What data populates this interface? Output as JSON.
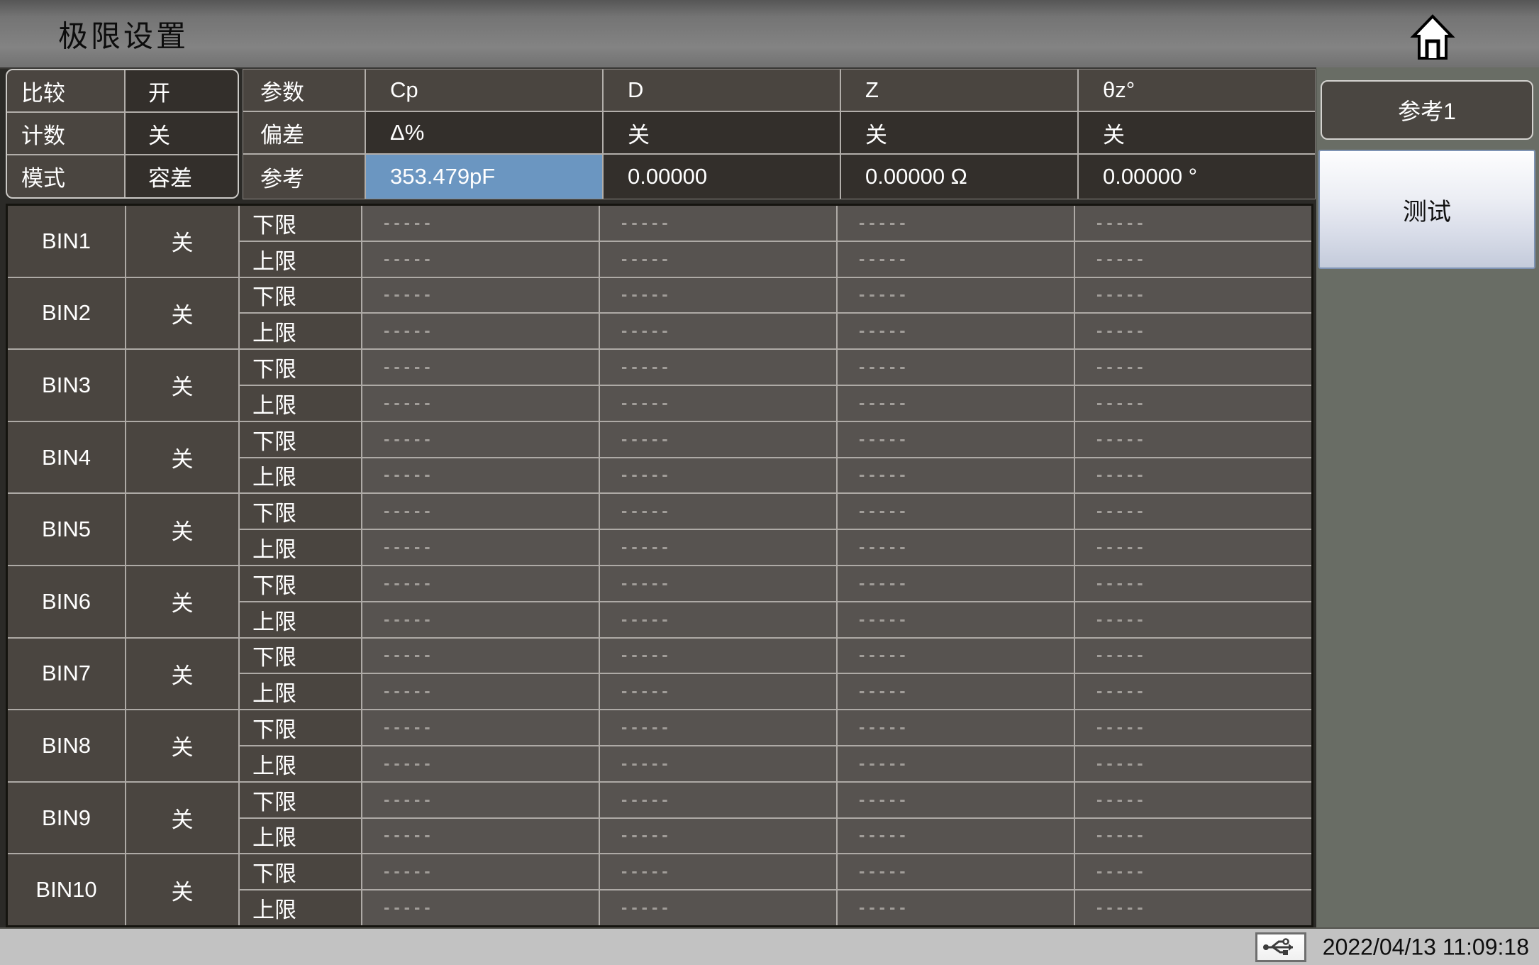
{
  "header": {
    "title": "极限设置",
    "home_icon": "home-icon"
  },
  "config": {
    "rows": [
      {
        "label": "比较",
        "value": "开"
      },
      {
        "label": "计数",
        "value": "关"
      },
      {
        "label": "模式",
        "value": "容差"
      }
    ]
  },
  "params": {
    "header": {
      "label": "参数",
      "values": [
        "Cp",
        "D",
        "Z",
        "θz°"
      ]
    },
    "deviation": {
      "label": "偏差",
      "values": [
        "Δ%",
        "关",
        "关",
        "关"
      ]
    },
    "reference": {
      "label": "参考",
      "values": [
        "353.479pF",
        "0.00000",
        "0.00000 Ω",
        "0.00000 °"
      ],
      "highlighted_index": 0
    }
  },
  "bin_table": {
    "lower_label": "下限",
    "upper_label": "上限",
    "empty_value": "-----",
    "bins": [
      {
        "name": "BIN1",
        "state": "关"
      },
      {
        "name": "BIN2",
        "state": "关"
      },
      {
        "name": "BIN3",
        "state": "关"
      },
      {
        "name": "BIN4",
        "state": "关"
      },
      {
        "name": "BIN5",
        "state": "关"
      },
      {
        "name": "BIN6",
        "state": "关"
      },
      {
        "name": "BIN7",
        "state": "关"
      },
      {
        "name": "BIN8",
        "state": "关"
      },
      {
        "name": "BIN9",
        "state": "关"
      },
      {
        "name": "BIN10",
        "state": "关"
      }
    ]
  },
  "side_panel": {
    "reference_button": "参考1",
    "test_button": "测试"
  },
  "status_bar": {
    "usb_icon": "usb-icon",
    "datetime": "2022/04/13 11:09:18"
  },
  "colors": {
    "highlight_blue": "#6b96c1",
    "cell_label_bg": "#4a4540",
    "cell_value_bg": "#332f2b",
    "cell_empty_bg": "#575350",
    "side_panel_bg": "#696d65",
    "status_bar_bg": "#c2c2c2",
    "titlebar_gray": "#7c7c7c"
  }
}
